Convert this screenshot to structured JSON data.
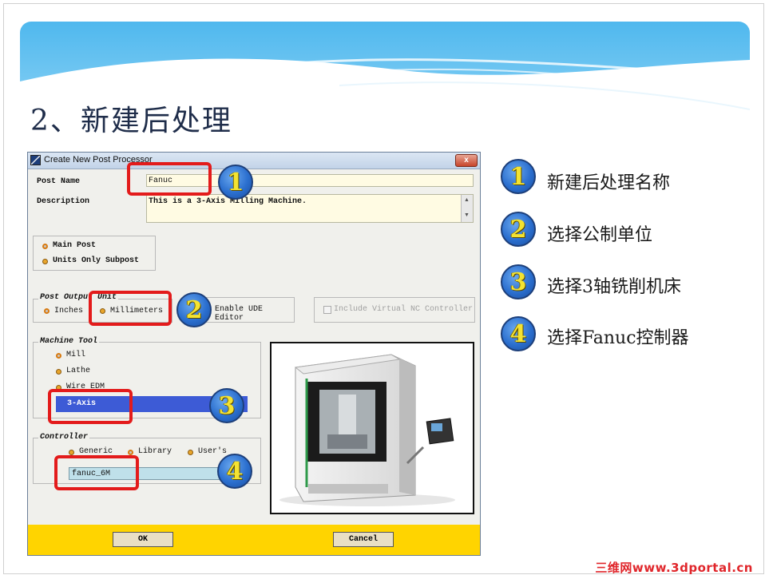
{
  "slide": {
    "title": "2、新建后处理",
    "watermark": "三维网www.3dportal.cn"
  },
  "dialog": {
    "title": "Create New Post Processor",
    "close_label": "x",
    "post_name_label": "Post Name",
    "post_name_value": "Fanuc",
    "description_label": "Description",
    "description_value": "This is a 3-Axis Milling Machine.",
    "post_type": {
      "main_post": "Main Post",
      "units_only": "Units Only Subpost"
    },
    "units": {
      "legend": "Post Output Unit",
      "inches": "Inches",
      "millimeters": "Millimeters"
    },
    "ude_editor": "Enable UDE Editor",
    "virtual_nc": "Include Virtual NC Controller",
    "machine_tool": {
      "legend": "Machine Tool",
      "mill": "Mill",
      "lathe": "Lathe",
      "wire_edm": "Wire EDM",
      "selected_axis": "3-Axis"
    },
    "controller": {
      "legend": "Controller",
      "generic": "Generic",
      "library": "Library",
      "users": "User's",
      "selected": "fanuc_6M"
    },
    "ok_label": "OK",
    "cancel_label": "Cancel"
  },
  "steps": [
    {
      "num": "1",
      "text": "新建后处理名称"
    },
    {
      "num": "2",
      "text": "选择公制单位"
    },
    {
      "num": "3",
      "text": "选择3轴铣削机床"
    },
    {
      "num": "4",
      "text": "选择Fanuc控制器"
    }
  ],
  "colors": {
    "accent_blue": "#2b6fcf",
    "highlight_red": "#e31b1b",
    "footer_yellow": "#ffd400",
    "selection_blue": "#3d5bd6"
  }
}
